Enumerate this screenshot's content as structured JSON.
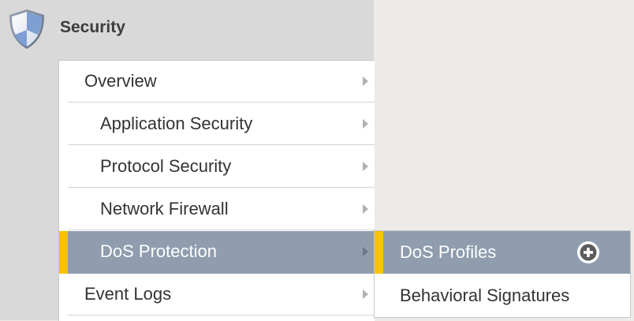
{
  "header": {
    "title": "Security",
    "icon": "shield-icon"
  },
  "menu": {
    "items": [
      {
        "label": "Overview",
        "level": "top",
        "has_submenu": true
      },
      {
        "label": "Application Security",
        "level": "sub",
        "has_submenu": true
      },
      {
        "label": "Protocol Security",
        "level": "sub",
        "has_submenu": true
      },
      {
        "label": "Network Firewall",
        "level": "sub",
        "has_submenu": true
      },
      {
        "label": "DoS Protection",
        "level": "sub",
        "has_submenu": true,
        "active": true
      },
      {
        "label": "Event Logs",
        "level": "top",
        "has_submenu": true
      }
    ]
  },
  "flyout": {
    "items": [
      {
        "label": "DoS Profiles",
        "active": true,
        "action_icon": "plus-circle-icon"
      },
      {
        "label": "Behavioral Signatures",
        "active": false
      }
    ]
  },
  "colors": {
    "active_bg": "#8f9dae",
    "accent": "#f7c200",
    "sidebar_bg": "#d9d9d9",
    "page_bg": "#ecebe9"
  }
}
